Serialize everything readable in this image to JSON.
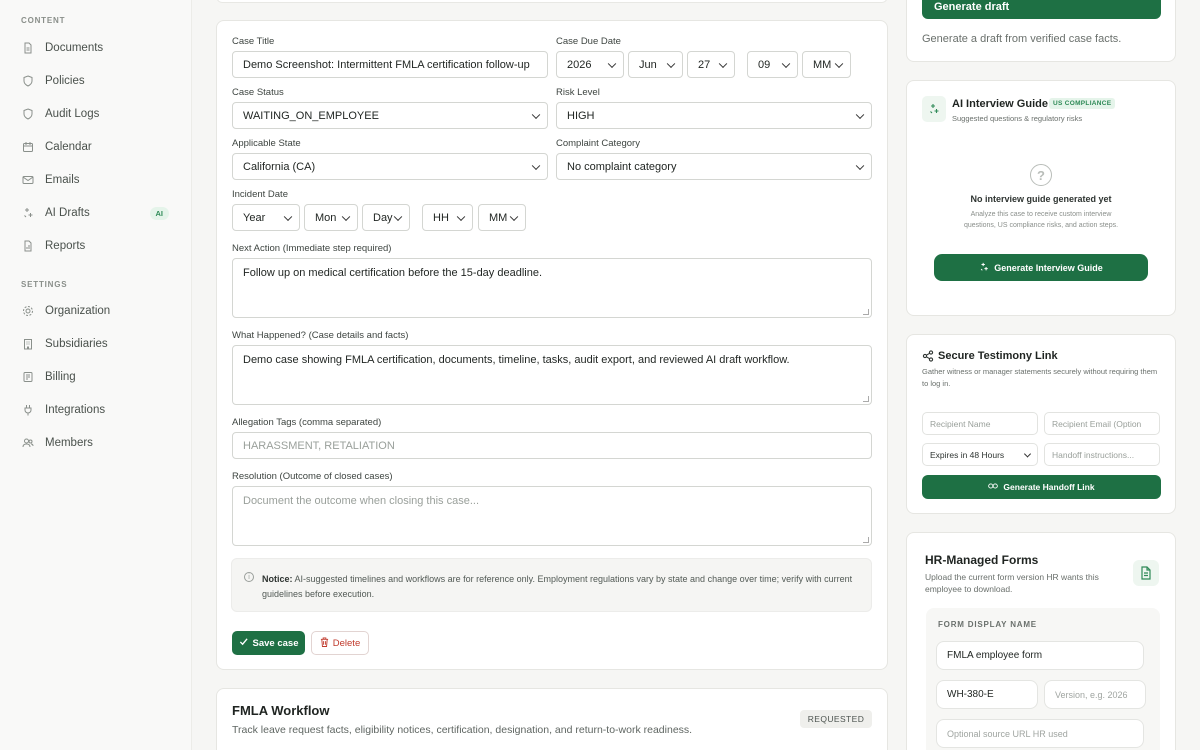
{
  "sidebar": {
    "content_label": "CONTENT",
    "settings_label": "SETTINGS",
    "content_items": [
      {
        "label": "Documents",
        "icon": "document-icon"
      },
      {
        "label": "Policies",
        "icon": "shield-icon"
      },
      {
        "label": "Audit Logs",
        "icon": "shield-icon"
      },
      {
        "label": "Calendar",
        "icon": "calendar-icon"
      },
      {
        "label": "Emails",
        "icon": "mail-icon"
      },
      {
        "label": "AI Drafts",
        "icon": "sparkle-icon",
        "badge": "AI"
      },
      {
        "label": "Reports",
        "icon": "report-icon"
      }
    ],
    "settings_items": [
      {
        "label": "Organization",
        "icon": "gear-icon"
      },
      {
        "label": "Subsidiaries",
        "icon": "building-icon"
      },
      {
        "label": "Billing",
        "icon": "card-icon"
      },
      {
        "label": "Integrations",
        "icon": "plug-icon"
      },
      {
        "label": "Members",
        "icon": "users-icon"
      }
    ]
  },
  "case_form": {
    "title_label": "Case Title",
    "title_value": "Demo Screenshot: Intermittent FMLA certification follow-up",
    "due_date_label": "Case Due Date",
    "due_year": "2026",
    "due_month": "Jun",
    "due_day": "27",
    "due_hour": "09",
    "due_minute": "MM",
    "status_label": "Case Status",
    "status_value": "WAITING_ON_EMPLOYEE",
    "risk_label": "Risk Level",
    "risk_value": "HIGH",
    "state_label": "Applicable State",
    "state_value": "California (CA)",
    "complaint_label": "Complaint Category",
    "complaint_value": "No complaint category",
    "incident_label": "Incident Date",
    "incident_year": "Year",
    "incident_month": "Mon",
    "incident_day": "Day",
    "incident_hour": "HH",
    "incident_minute": "MM",
    "next_action_label": "Next Action (Immediate step required)",
    "next_action_value": "Follow up on medical certification before the 15-day deadline.",
    "what_happened_label": "What Happened? (Case details and facts)",
    "what_happened_value": "Demo case showing FMLA certification, documents, timeline, tasks, audit export, and reviewed AI draft workflow.",
    "tags_label": "Allegation Tags (comma separated)",
    "tags_placeholder": "HARASSMENT, RETALIATION",
    "resolution_label": "Resolution (Outcome of closed cases)",
    "resolution_placeholder": "Document the outcome when closing this case...",
    "notice_bold": "Notice:",
    "notice_text": "AI-suggested timelines and workflows are for reference only. Employment regulations vary by state and change over time; verify with current guidelines before execution.",
    "save_label": "Save case",
    "delete_label": "Delete"
  },
  "fmla": {
    "title": "FMLA Workflow",
    "subtitle": "Track leave request facts, eligibility notices, certification, designation, and return-to-work readiness.",
    "status": "REQUESTED"
  },
  "draft": {
    "button": "Generate draft",
    "text": "Generate a draft from verified case facts."
  },
  "interview": {
    "title": "AI Interview Guide",
    "badge": "US COMPLIANCE",
    "subtitle": "Suggested questions & regulatory risks",
    "empty_title": "No interview guide generated yet",
    "empty_sub": "Analyze this case to receive custom interview questions, US compliance risks, and action steps.",
    "button": "Generate Interview Guide"
  },
  "testimony": {
    "title": "Secure Testimony Link",
    "subtitle": "Gather witness or manager statements securely without requiring them to log in.",
    "recipient_name_ph": "Recipient Name",
    "recipient_email_ph": "Recipient Email (Option",
    "expiry_value": "Expires in 48 Hours",
    "handoff_ph": "Handoff instructions...",
    "button": "Generate Handoff Link"
  },
  "forms": {
    "title": "HR-Managed Forms",
    "subtitle": "Upload the current form version HR wants this employee to download.",
    "display_name_label": "FORM DISPLAY NAME",
    "display_name_value": "FMLA employee form",
    "form_code": "WH-380-E",
    "version_ph": "Version, e.g. 2026",
    "source_ph": "Optional source URL HR used"
  }
}
